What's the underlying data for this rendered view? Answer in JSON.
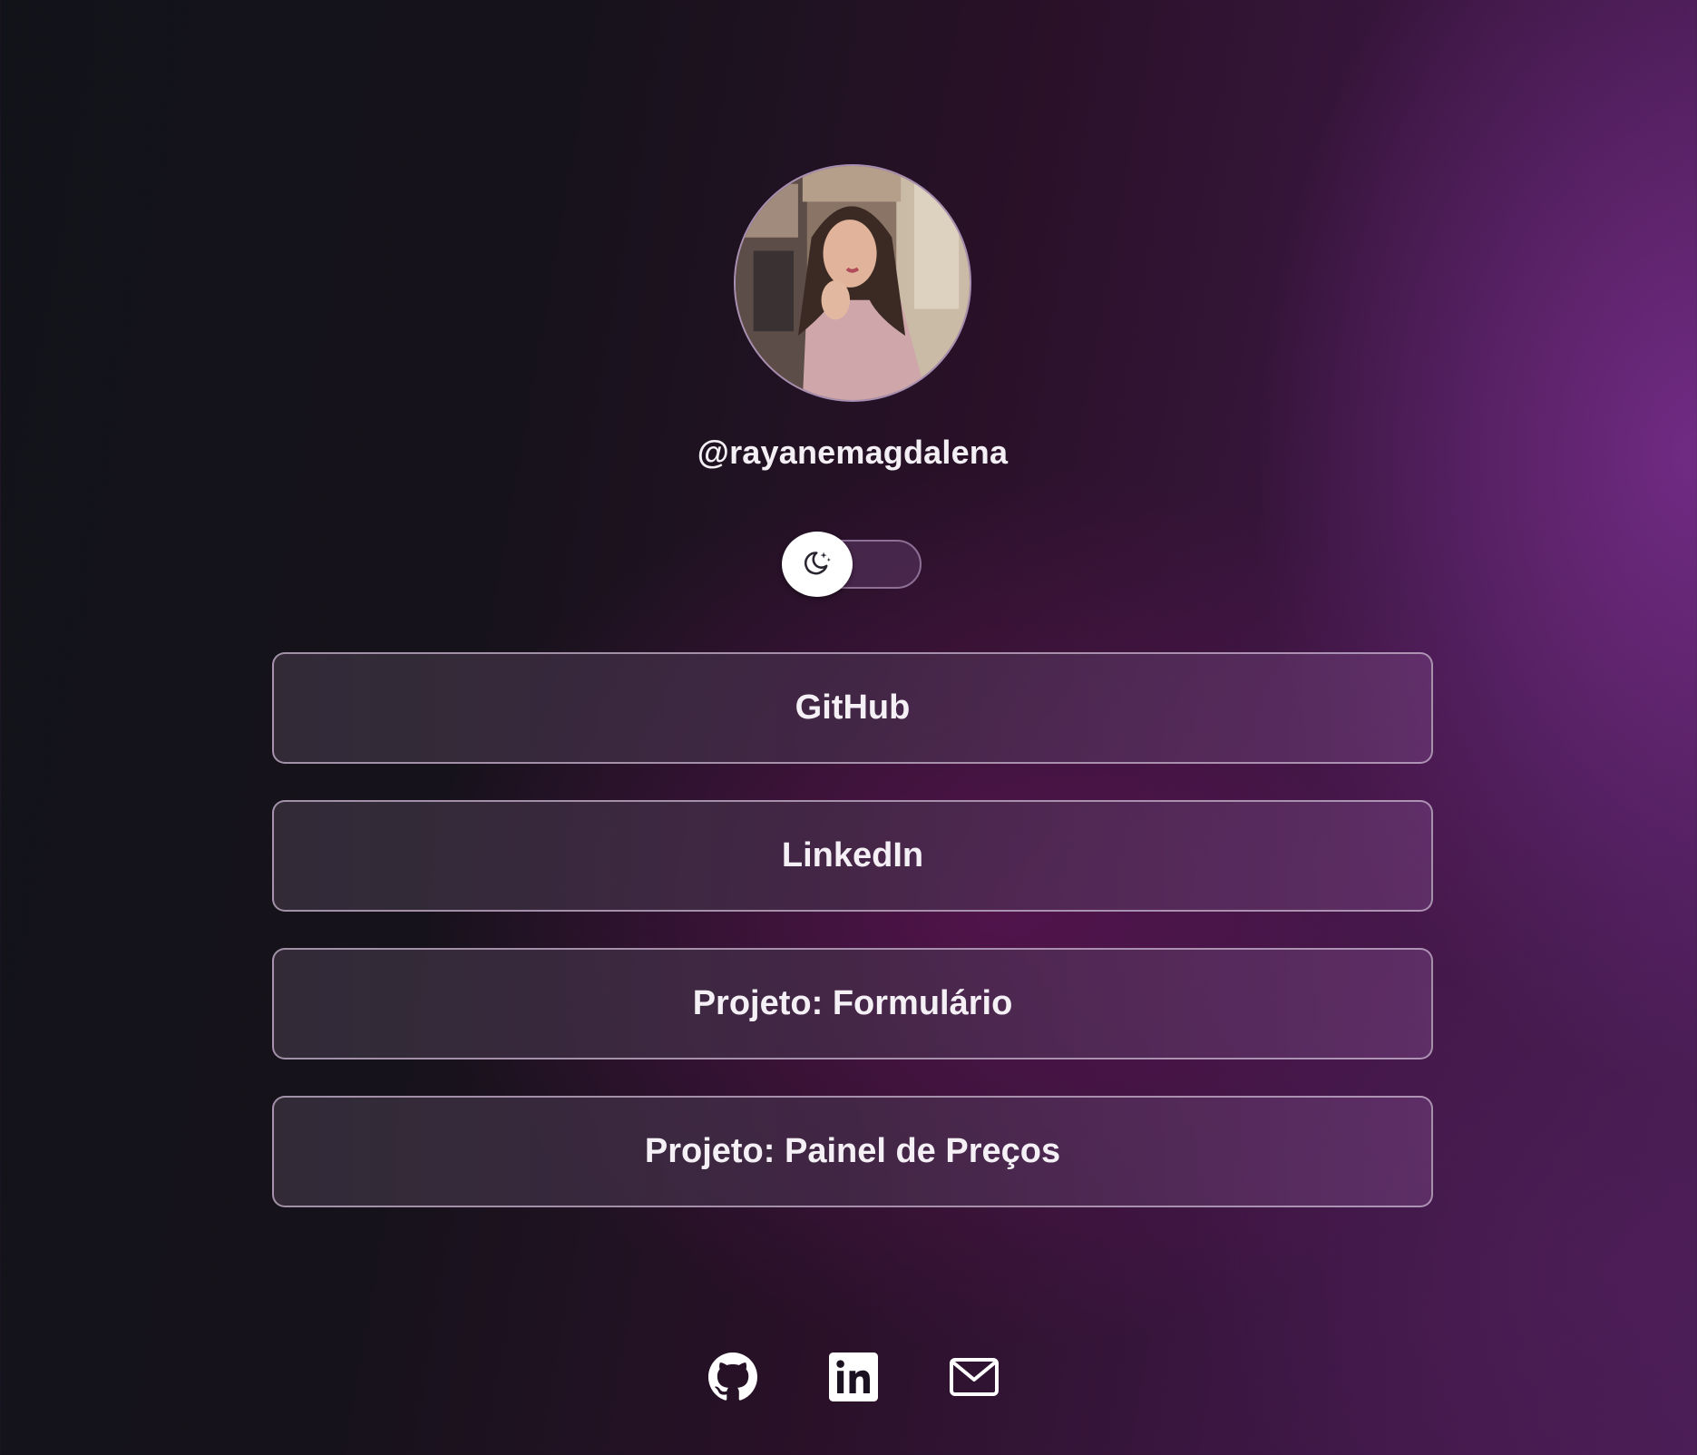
{
  "profile": {
    "username": "@rayanemagdalena"
  },
  "theme_toggle": {
    "icon": "moon-stars-icon",
    "state": "dark"
  },
  "links": [
    {
      "label": "GitHub"
    },
    {
      "label": "LinkedIn"
    },
    {
      "label": "Projeto: Formulário"
    },
    {
      "label": "Projeto: Painel de Preços"
    }
  ],
  "social_icons": [
    "github-icon",
    "linkedin-icon",
    "mail-icon"
  ],
  "colors": {
    "background_dark": "#121319",
    "background_accent": "#5a2266",
    "text": "#f3eff5",
    "button_border": "#c8b4cd"
  }
}
